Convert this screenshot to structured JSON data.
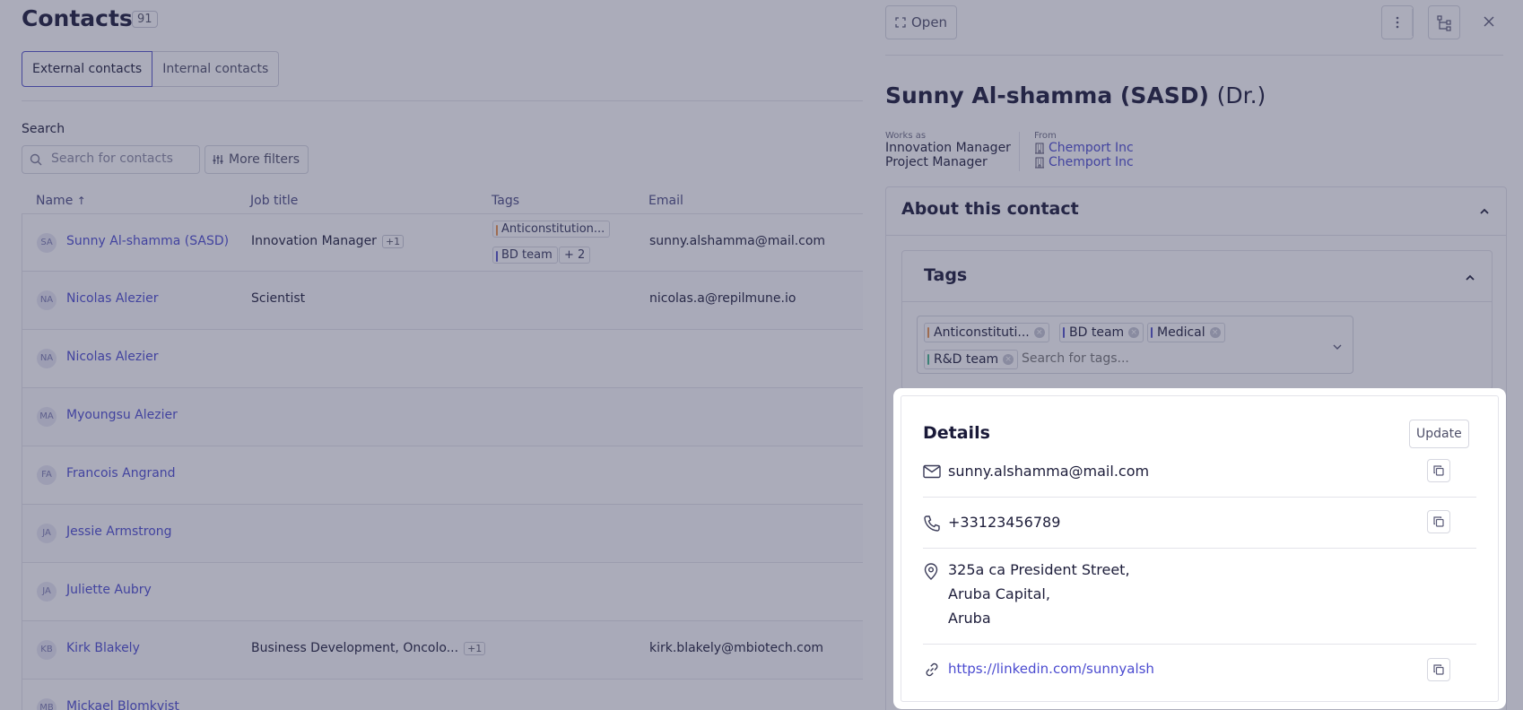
{
  "page": {
    "title": "Contacts",
    "count": "91"
  },
  "tabs": [
    {
      "label": "External contacts",
      "active": true
    },
    {
      "label": "Internal contacts",
      "active": false
    }
  ],
  "search": {
    "label": "Search",
    "placeholder": "Search for contacts",
    "more_filters": "More filters"
  },
  "columns": {
    "name": "Name",
    "job": "Job title",
    "tags": "Tags",
    "email": "Email"
  },
  "rows": [
    {
      "initials": "SA",
      "name": "Sunny Al-shamma (SASD)",
      "job": "Innovation Manager",
      "job_more": "+1",
      "tags": [
        {
          "label": "Anticonstitution...",
          "color": "#e8914a"
        },
        {
          "label": "BD team",
          "color": "#5151c9"
        }
      ],
      "tags_more": "+ 2",
      "email": "sunny.alshamma@mail.com"
    },
    {
      "initials": "NA",
      "name": "Nicolas Alezier",
      "job": "Scientist",
      "email": "nicolas.a@repilmune.io"
    },
    {
      "initials": "NA",
      "name": "Nicolas Alezier",
      "job": "",
      "email": ""
    },
    {
      "initials": "MA",
      "name": "Myoungsu Alezier",
      "job": "",
      "email": ""
    },
    {
      "initials": "FA",
      "name": "Francois Angrand",
      "job": "",
      "email": ""
    },
    {
      "initials": "JA",
      "name": "Jessie Armstrong",
      "job": "",
      "email": ""
    },
    {
      "initials": "JA",
      "name": "Juliette Aubry",
      "job": "",
      "email": ""
    },
    {
      "initials": "KB",
      "name": "Kirk Blakely",
      "job": "Business Development, Oncolo...",
      "job_more": "+1",
      "email": "kirk.blakely@mbiotech.com"
    },
    {
      "initials": "MB",
      "name": "Mickael Blomkvist",
      "job": "",
      "email": ""
    }
  ],
  "drawer": {
    "open_label": "Open",
    "name": "Sunny Al-shamma (SASD)",
    "honorific": "(Dr.)",
    "works_as_label": "Works as",
    "roles": [
      "Innovation Manager",
      "Project Manager"
    ],
    "from_label": "From",
    "companies": [
      "Chemport Inc",
      "Chemport Inc"
    ],
    "about_title": "About this contact",
    "tags_title": "Tags",
    "tags": [
      {
        "label": "Anticonstituti...",
        "color": "#e8914a"
      },
      {
        "label": "BD team",
        "color": "#5151c9"
      },
      {
        "label": "Medical",
        "color": "#5151c9"
      },
      {
        "label": "R&D team",
        "color": "#3fb58a"
      }
    ],
    "tags_placeholder": "Search for tags..."
  },
  "details": {
    "title": "Details",
    "update": "Update",
    "email": "sunny.alshamma@mail.com",
    "phone": "+33123456789",
    "address_lines": [
      "325a ca President Street,",
      "Aruba Capital,",
      "Aruba"
    ],
    "linkedin": "https://linkedin.com/sunnyalsh"
  },
  "icons": {
    "search": "search-icon",
    "filters": "sliders-icon",
    "sort": "arrow-up-icon",
    "expand": "expand-icon",
    "more": "vertical-dots-icon",
    "hierarchy": "hierarchy-icon",
    "close": "close-icon",
    "building": "building-icon",
    "chevron_up": "chevron-up-icon",
    "chevron_down": "chevron-down-icon",
    "mail": "mail-icon",
    "phone": "phone-icon",
    "pin": "map-pin-icon",
    "link": "link-icon",
    "copy": "copy-icon"
  }
}
